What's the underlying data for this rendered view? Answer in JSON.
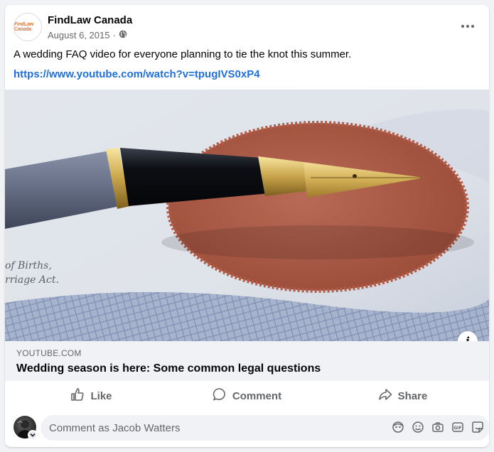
{
  "post": {
    "page_name": "FindLaw Canada",
    "avatar_logo_text": "FindLaw Canada",
    "date": "August 6, 2015",
    "separator": "·",
    "audience_icon": "globe-icon",
    "text": "A wedding FAQ video for everyone planning to tie the knot this summer.",
    "link": "https://www.youtube.com/watch?v=tpugIVS0xP4"
  },
  "preview": {
    "image_subject": "fountain pen on certificate with red seal",
    "cert_text_line1": "of Births,",
    "cert_text_line2": "rriage Act.",
    "domain": "YOUTUBE.COM",
    "title": "Wedding season is here: Some common legal questions",
    "info_label": "i"
  },
  "actions": {
    "like": "Like",
    "comment": "Comment",
    "share": "Share"
  },
  "comment": {
    "placeholder": "Comment as Jacob Watters"
  },
  "colors": {
    "link": "#216fdb",
    "muted": "#65676b",
    "background": "#f0f2f5"
  }
}
